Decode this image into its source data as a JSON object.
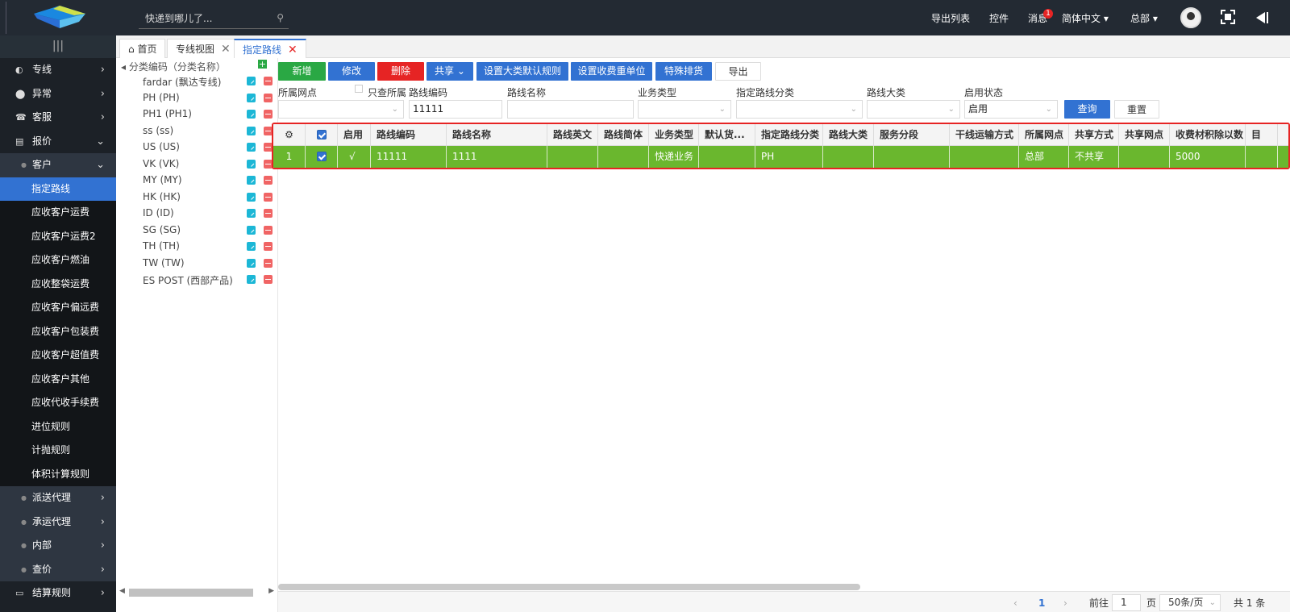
{
  "header": {
    "search_placeholder": "快递到哪儿了...",
    "export_list": "导出列表",
    "controls": "控件",
    "messages": "消息",
    "message_count": "1",
    "language": "简体中文 ▾",
    "org": "总部 ▾"
  },
  "sidebar": {
    "items": [
      {
        "label": "专线",
        "icon": "◐"
      },
      {
        "label": "异常",
        "icon": "⬤"
      },
      {
        "label": "客服",
        "icon": "☎"
      },
      {
        "label": "报价",
        "icon": "▤"
      }
    ],
    "sub_items": [
      {
        "label": "客户"
      },
      {
        "label": "指定路线"
      },
      {
        "label": "应收客户运费"
      },
      {
        "label": "应收客户运费2"
      },
      {
        "label": "应收客户燃油"
      },
      {
        "label": "应收整袋运费"
      },
      {
        "label": "应收客户偏远费"
      },
      {
        "label": "应收客户包装费"
      },
      {
        "label": "应收客户超值费"
      },
      {
        "label": "应收客户其他"
      },
      {
        "label": "应收代收手续费"
      },
      {
        "label": "进位规则"
      },
      {
        "label": "计抛规则"
      },
      {
        "label": "体积计算规则"
      },
      {
        "label": "派送代理"
      },
      {
        "label": "承运代理"
      },
      {
        "label": "内部"
      },
      {
        "label": "查价"
      }
    ],
    "bottom": {
      "label": "结算规则"
    }
  },
  "tabs": [
    {
      "label": "首页"
    },
    {
      "label": "专线视图"
    },
    {
      "label": "指定路线"
    }
  ],
  "tree": {
    "header": "分类编码（分类名称）",
    "items": [
      "fardar (飘达专线)",
      "PH (PH)",
      "PH1 (PH1)",
      "ss (ss)",
      "US (US)",
      "VK (VK)",
      "MY (MY)",
      "HK (HK)",
      "ID (ID)",
      "SG (SG)",
      "TH (TH)",
      "TW (TW)",
      "ES POST (西部产品)"
    ]
  },
  "toolbar": {
    "add": "新增",
    "edit": "修改",
    "delete": "删除",
    "share": "共享",
    "set_default_rule": "设置大类默认规则",
    "set_fee_unit": "设置收费重单位",
    "special": "特殊排货",
    "export": "导出"
  },
  "filters": {
    "branch_label": "所属网点",
    "only_own": "只查所属",
    "route_code_label": "路线编码",
    "route_code_value": "11111",
    "route_name_label": "路线名称",
    "biz_type_label": "业务类型",
    "route_cat_label": "指定路线分类",
    "route_class_label": "路线大类",
    "status_label": "启用状态",
    "status_value": "启用",
    "query": "查询",
    "reset": "重置"
  },
  "grid": {
    "headers": [
      "启用",
      "路线编码",
      "路线名称",
      "路线英文",
      "路线简体",
      "业务类型",
      "默认货...",
      "指定路线分类",
      "路线大类",
      "服务分段",
      "干线运输方式",
      "所属网点",
      "共享方式",
      "共享网点",
      "收费材积除以数",
      "目"
    ],
    "rows": [
      {
        "index": "1",
        "cells": [
          "√",
          "11111",
          "1111",
          "",
          "",
          "快递业务",
          "",
          "PH",
          "",
          "",
          "",
          "总部",
          "不共享",
          "",
          "5000",
          ""
        ]
      }
    ]
  },
  "pager": {
    "current": "1",
    "goto_label": "前往",
    "goto_value": "1",
    "page_unit": "页",
    "page_size": "50条/页",
    "total": "共 1 条"
  },
  "colors": {
    "accent": "#3272d2",
    "green": "#2aa844",
    "red": "#e62424",
    "row_selected": "#6ab72e",
    "topbar": "#232a33"
  }
}
